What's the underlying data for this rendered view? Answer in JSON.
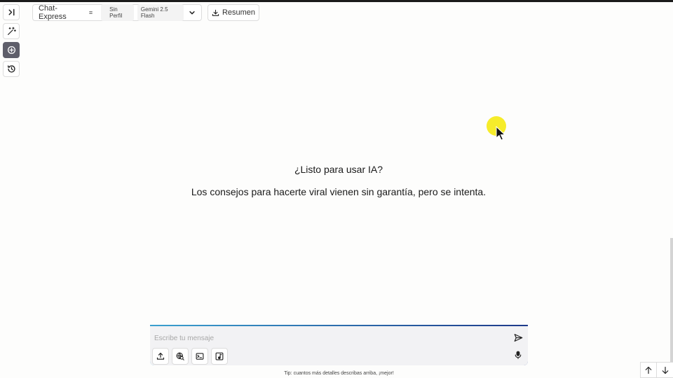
{
  "header": {
    "chat_title": "Chat-Express",
    "profile_label": "Sin Perfil",
    "model_label": "Gemini 2.5 Flash",
    "summary_label": "Resumen"
  },
  "sidebar": {
    "items": [
      {
        "icon": "collapse-panel-icon"
      },
      {
        "icon": "magic-wand-icon"
      },
      {
        "icon": "new-chat-plus-icon"
      },
      {
        "icon": "history-icon"
      }
    ],
    "active_index": 2
  },
  "hero": {
    "title": "¿Listo para usar IA?",
    "subtitle": "Los consejos para hacerte viral vienen sin garantía, pero se intenta."
  },
  "composer": {
    "value": "",
    "placeholder": "Escribe tu mensaje",
    "tools": [
      "upload-icon",
      "web-search-icon",
      "terminal-icon",
      "music-note-icon"
    ]
  },
  "tip": "Tip: cuantos más detalles describas arriba, ¡mejor!",
  "colors": {
    "accent_gradient_start": "#3aa0cf",
    "accent_gradient_end": "#1e3a8a",
    "active_rail": "#5f5f6b",
    "cursor_highlight": "#f6ec2a"
  }
}
